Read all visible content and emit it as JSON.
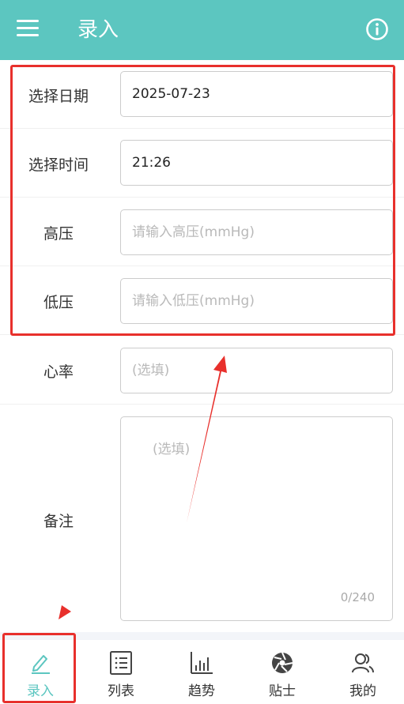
{
  "header": {
    "title": "录入",
    "menu_icon": "menu-icon",
    "info_icon": "info-icon",
    "background": "#5cc6c0"
  },
  "form": {
    "date": {
      "label": "选择日期",
      "value": "2025-07-23"
    },
    "time": {
      "label": "选择时间",
      "value": "21:26"
    },
    "systolic": {
      "label": "高压",
      "placeholder": "请输入高压(mmHg)"
    },
    "diastolic": {
      "label": "低压",
      "placeholder": "请输入低压(mmHg)"
    },
    "heart_rate": {
      "label": "心率",
      "placeholder": "(选填)"
    },
    "note": {
      "label": "备注",
      "placeholder": "(选填)",
      "counter": "0/240"
    }
  },
  "tabbar": {
    "items": [
      {
        "label": "录入",
        "icon": "pencil-icon",
        "active": true
      },
      {
        "label": "列表",
        "icon": "list-icon",
        "active": false
      },
      {
        "label": "趋势",
        "icon": "bar-chart-icon",
        "active": false
      },
      {
        "label": "贴士",
        "icon": "aperture-icon",
        "active": false
      },
      {
        "label": "我的",
        "icon": "users-icon",
        "active": false
      }
    ]
  },
  "colors": {
    "accent": "#5cc6c0",
    "annotation": "#e8302c"
  }
}
